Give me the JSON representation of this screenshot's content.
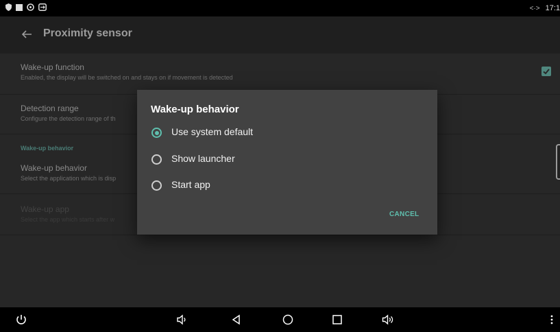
{
  "status_bar": {
    "left_icons": [
      "shield-icon",
      "notification-square-icon",
      "sync-circle-icon",
      "remote-control-icon"
    ],
    "signal_glyph": "<·>",
    "time": "17:1"
  },
  "app_bar": {
    "title": "Proximity sensor"
  },
  "preferences": {
    "wake_function": {
      "title": "Wake-up function",
      "summary": "Enabled, the display will be switched on and stays on if movement is detected",
      "checked": true
    },
    "detection_range": {
      "title": "Detection range",
      "summary": "Configure the detection range of th"
    },
    "category": "Wake-up behavior",
    "wake_behavior": {
      "title": "Wake-up behavior",
      "summary": "Select the application which is disp"
    },
    "wake_app": {
      "title": "Wake-up app",
      "summary": "Select the app which starts after w",
      "enabled": false
    }
  },
  "dialog": {
    "title": "Wake-up behavior",
    "options": [
      {
        "label": "Use system default",
        "selected": true
      },
      {
        "label": "Show launcher",
        "selected": false
      },
      {
        "label": "Start app",
        "selected": false
      }
    ],
    "cancel": "CANCEL"
  },
  "nav_bar": {
    "buttons": [
      "power-icon",
      "volume-down-icon",
      "back-icon",
      "home-icon",
      "recents-icon",
      "volume-up-icon",
      "more-vert-icon"
    ]
  },
  "colors": {
    "accent": "#5fbfae",
    "background": "#272727",
    "dialog": "#424242"
  }
}
